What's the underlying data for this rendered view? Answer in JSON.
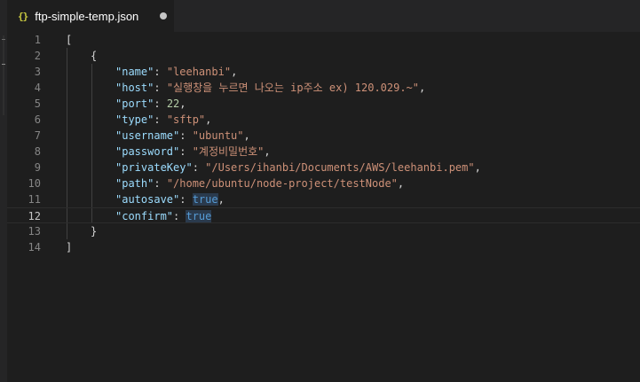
{
  "tab": {
    "icon_glyph": "{}",
    "filename": "ftp-simple-temp.json",
    "dirty": true
  },
  "editor": {
    "lines": [
      {
        "n": "1",
        "open": "[",
        "close": ""
      },
      {
        "n": "2",
        "open": "{",
        "close": ""
      },
      {
        "n": "3",
        "key": "\"name\"",
        "sep": ": ",
        "val": "\"leehanbi\"",
        "vtype": "str",
        "end": ","
      },
      {
        "n": "4",
        "key": "\"host\"",
        "sep": ": ",
        "val": "\"실행창을 누르면 나오는 ip주소 ex) 120.029.~\"",
        "vtype": "str",
        "end": ","
      },
      {
        "n": "5",
        "key": "\"port\"",
        "sep": ": ",
        "val": "22",
        "vtype": "num",
        "end": ","
      },
      {
        "n": "6",
        "key": "\"type\"",
        "sep": ": ",
        "val": "\"sftp\"",
        "vtype": "str",
        "end": ","
      },
      {
        "n": "7",
        "key": "\"username\"",
        "sep": ": ",
        "val": "\"ubuntu\"",
        "vtype": "str",
        "end": ","
      },
      {
        "n": "8",
        "key": "\"password\"",
        "sep": ": ",
        "val": "\"계정비밀번호\"",
        "vtype": "str",
        "end": ","
      },
      {
        "n": "9",
        "key": "\"privateKey\"",
        "sep": ": ",
        "val": "\"/Users/ihanbi/Documents/AWS/leehanbi.pem\"",
        "vtype": "str",
        "end": ","
      },
      {
        "n": "10",
        "key": "\"path\"",
        "sep": ": ",
        "val": "\"/home/ubuntu/node-project/testNode\"",
        "vtype": "str",
        "end": ","
      },
      {
        "n": "11",
        "key": "\"autosave\"",
        "sep": ": ",
        "val": "true",
        "vtype": "bool",
        "end": ","
      },
      {
        "n": "12",
        "key": "\"confirm\"",
        "sep": ": ",
        "val": "true",
        "vtype": "bool",
        "end": ""
      },
      {
        "n": "13",
        "open": "}",
        "close": ""
      },
      {
        "n": "14",
        "open": "]",
        "close": ""
      }
    ],
    "current_line": "12"
  },
  "colors": {
    "background": "#1e1e1e",
    "key": "#9cdcfe",
    "string": "#ce9178",
    "number": "#b5cea8",
    "boolean": "#569cd6",
    "icon": "#cbcb41"
  }
}
